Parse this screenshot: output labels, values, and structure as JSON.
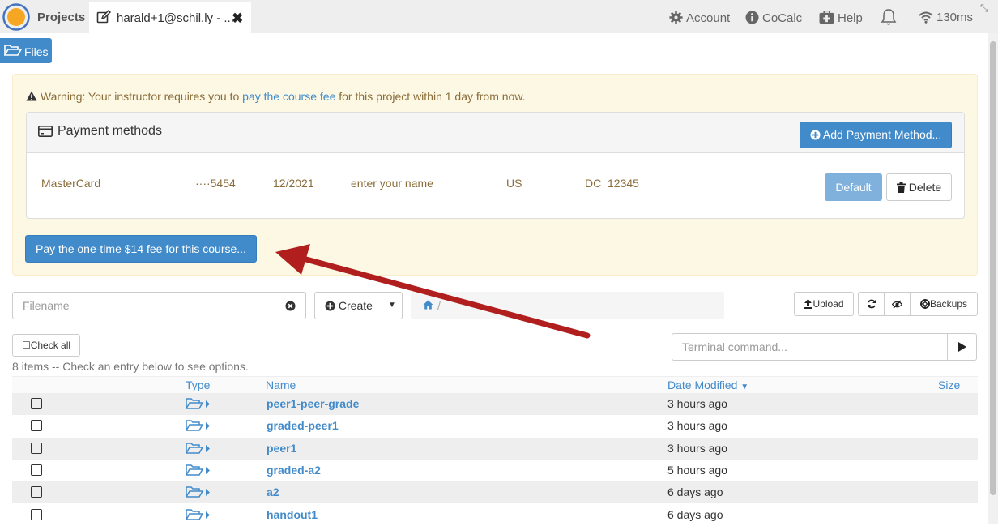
{
  "topbar": {
    "projects_label": "Projects",
    "file_tab_label": "harald+1@schil.ly - ...",
    "account_label": "Account",
    "cocalc_label": "CoCalc",
    "help_label": "Help",
    "ping_label": "130ms"
  },
  "files_button_label": "Files",
  "warning": {
    "prefix": "Warning: Your instructor requires you to ",
    "link": "pay the course fee",
    "suffix": " for this project within 1 day from now."
  },
  "payment_methods": {
    "title": "Payment methods",
    "add_button": "Add Payment Method...",
    "card": {
      "brand": "MasterCard",
      "number": "····5454",
      "expiry": "12/2021",
      "name": "enter your name",
      "country": "US",
      "state_zip": "DC  12345"
    },
    "default_button": "Default",
    "delete_button": "Delete"
  },
  "pay_button": "Pay the one-time $14 fee for this course...",
  "toolbar": {
    "filename_placeholder": "Filename",
    "create_label": "Create",
    "upload_label": "Upload",
    "backups_label": "Backups",
    "check_all_label": "Check all",
    "terminal_placeholder": "Terminal command..."
  },
  "items_count_text": "8 items -- Check an entry below to see options.",
  "table": {
    "headers": {
      "type": "Type",
      "name": "Name",
      "date": "Date Modified",
      "size": "Size"
    },
    "rows": [
      {
        "name": "peer1-peer-grade",
        "date": "3 hours ago"
      },
      {
        "name": "graded-peer1",
        "date": "3 hours ago"
      },
      {
        "name": "peer1",
        "date": "3 hours ago"
      },
      {
        "name": "graded-a2",
        "date": "5 hours ago"
      },
      {
        "name": "a2",
        "date": "6 days ago"
      },
      {
        "name": "handout1",
        "date": "6 days ago"
      }
    ]
  },
  "colors": {
    "primary": "#428bca",
    "warning_bg": "#fcf8e3",
    "warning_text": "#8a6d3b",
    "arrow": "#b01e1e",
    "logo": "#f5a623"
  }
}
